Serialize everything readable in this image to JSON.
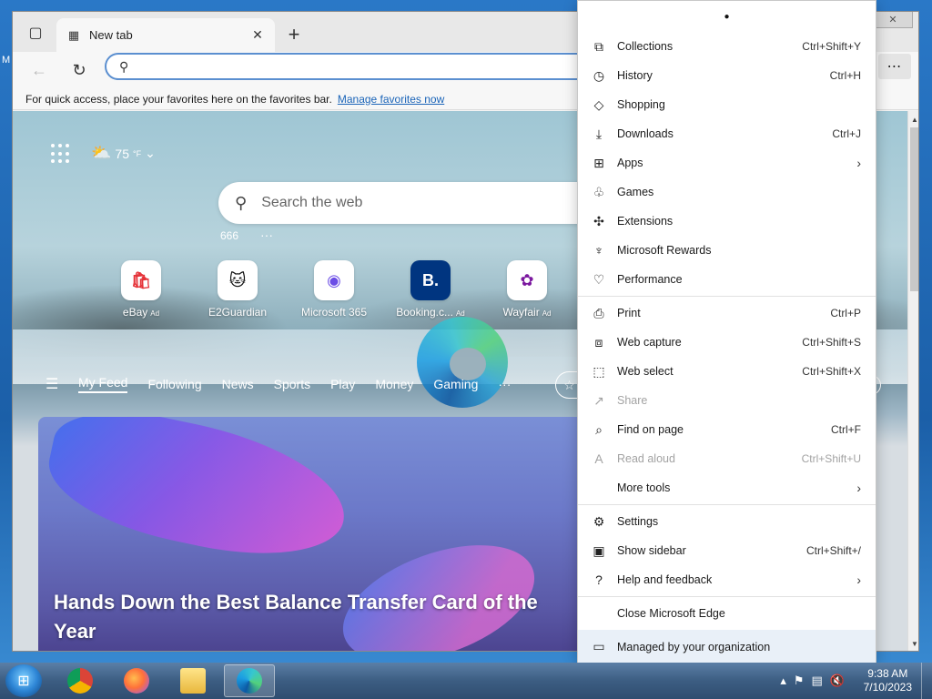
{
  "desktop": {
    "label": "M"
  },
  "browser": {
    "tab": {
      "title": "New tab"
    },
    "window_close": "✕",
    "address_placeholder": "",
    "favorites_bar": {
      "text": "For quick access, place your favorites here on the favorites bar.",
      "link": "Manage favorites now"
    }
  },
  "newtab": {
    "weather": {
      "temp": "75",
      "unit": "°F"
    },
    "search_placeholder": "Search the web",
    "rewards_count": "666",
    "quicklinks": [
      {
        "label": "eBay",
        "ad": "Ad",
        "glyph": "🛍"
      },
      {
        "label": "E2Guardian",
        "ad": "",
        "glyph": "🐱"
      },
      {
        "label": "Microsoft 365",
        "ad": "",
        "glyph": "◉"
      },
      {
        "label": "Booking.c...",
        "ad": "Ad",
        "glyph": "B."
      },
      {
        "label": "Wayfair",
        "ad": "Ad",
        "glyph": "✿"
      }
    ],
    "feed_tabs": [
      "My Feed",
      "Following",
      "News",
      "Sports",
      "Play",
      "Money",
      "Gaming"
    ],
    "hero_title": "Hands Down the Best Balance Transfer Card of the Year"
  },
  "menu": {
    "groups": [
      [
        {
          "label": "Collections",
          "shortcut": "Ctrl+Shift+Y",
          "icon": "collections-icon"
        },
        {
          "label": "History",
          "shortcut": "Ctrl+H",
          "icon": "history-icon"
        },
        {
          "label": "Shopping",
          "shortcut": "",
          "icon": "shopping-tag-icon"
        },
        {
          "label": "Downloads",
          "shortcut": "Ctrl+J",
          "icon": "download-icon"
        },
        {
          "label": "Apps",
          "shortcut": "",
          "icon": "apps-icon",
          "submenu": true
        },
        {
          "label": "Games",
          "shortcut": "",
          "icon": "games-icon"
        },
        {
          "label": "Extensions",
          "shortcut": "",
          "icon": "puzzle-icon"
        },
        {
          "label": "Microsoft Rewards",
          "shortcut": "",
          "icon": "rewards-trophy-icon"
        },
        {
          "label": "Performance",
          "shortcut": "",
          "icon": "heartbeat-icon"
        }
      ],
      [
        {
          "label": "Print",
          "shortcut": "Ctrl+P",
          "icon": "print-icon"
        },
        {
          "label": "Web capture",
          "shortcut": "Ctrl+Shift+S",
          "icon": "web-capture-icon"
        },
        {
          "label": "Web select",
          "shortcut": "Ctrl+Shift+X",
          "icon": "web-select-icon"
        },
        {
          "label": "Share",
          "shortcut": "",
          "icon": "share-icon",
          "disabled": true
        },
        {
          "label": "Find on page",
          "shortcut": "Ctrl+F",
          "icon": "find-icon"
        },
        {
          "label": "Read aloud",
          "shortcut": "Ctrl+Shift+U",
          "icon": "read-aloud-icon",
          "disabled": true
        },
        {
          "label": "More tools",
          "shortcut": "",
          "icon": "none",
          "submenu": true
        }
      ],
      [
        {
          "label": "Settings",
          "shortcut": "",
          "icon": "gear-icon"
        },
        {
          "label": "Show sidebar",
          "shortcut": "Ctrl+Shift+/",
          "icon": "sidebar-icon"
        },
        {
          "label": "Help and feedback",
          "shortcut": "",
          "icon": "help-icon",
          "submenu": true
        }
      ],
      [
        {
          "label": "Close Microsoft Edge",
          "shortcut": "",
          "icon": "none"
        }
      ]
    ],
    "managed": "Managed by your organization"
  },
  "taskbar": {
    "time": "9:38 AM",
    "date": "7/10/2023"
  }
}
